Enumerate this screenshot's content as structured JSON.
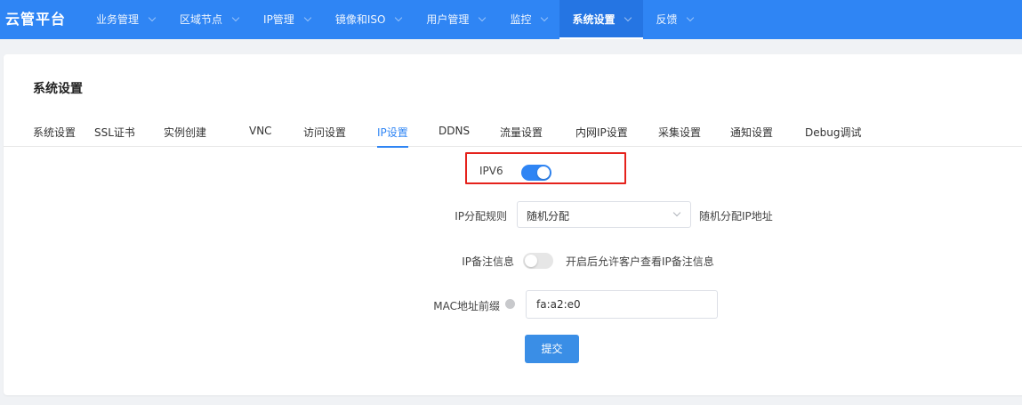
{
  "app": {
    "brand": "云管平台"
  },
  "nav": {
    "items": [
      {
        "label": "业务管理"
      },
      {
        "label": "区域节点"
      },
      {
        "label": "IP管理"
      },
      {
        "label": "镜像和ISO"
      },
      {
        "label": "用户管理"
      },
      {
        "label": "监控"
      },
      {
        "label": "系统设置"
      },
      {
        "label": "反馈"
      }
    ],
    "active": "系统设置",
    "accent_color": "#2f85f4"
  },
  "page": {
    "title": "系统设置",
    "tabs": [
      {
        "label": "系统设置"
      },
      {
        "label": "SSL证书"
      },
      {
        "label": "实例创建"
      },
      {
        "label": "VNC"
      },
      {
        "label": "访问设置"
      },
      {
        "label": "IP设置"
      },
      {
        "label": "DDNS"
      },
      {
        "label": "流量设置"
      },
      {
        "label": "内网IP设置"
      },
      {
        "label": "采集设置"
      },
      {
        "label": "通知设置"
      },
      {
        "label": "Debug调试"
      }
    ],
    "active_tab": "IP设置"
  },
  "form": {
    "ipv6": {
      "label": "IPV6",
      "enabled": true
    },
    "ip_rule": {
      "label": "IP分配规则",
      "value": "随机分配",
      "hint": "随机分配IP地址"
    },
    "ip_remark": {
      "label": "IP备注信息",
      "enabled": false,
      "hint": "开启后允许客户查看IP备注信息"
    },
    "mac_prefix": {
      "label": "MAC地址前缀",
      "value": "fa:a2:e0",
      "icon": "info-icon"
    },
    "submit_label": "提交"
  },
  "colors": {
    "primary": "#2f85f4",
    "highlight_border": "#e5221c",
    "switch_off": "#e6e6e6"
  }
}
